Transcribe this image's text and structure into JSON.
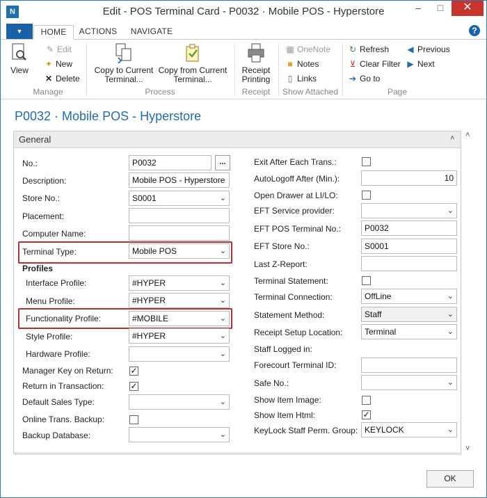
{
  "window": {
    "title": "Edit - POS Terminal Card - P0032 · Mobile POS - Hyperstore",
    "min_glyph": "–",
    "max_glyph": "□",
    "close_glyph": "✕"
  },
  "menubar": {
    "file_glyph": "▼",
    "tabs": [
      "HOME",
      "ACTIONS",
      "NAVIGATE"
    ],
    "help_glyph": "?"
  },
  "ribbon": {
    "manage": {
      "label": "Manage",
      "view": "View",
      "edit": "Edit",
      "new": "New",
      "delete": "Delete"
    },
    "process": {
      "label": "Process",
      "copy_to_line1": "Copy to Current",
      "copy_to_line2": "Terminal...",
      "copy_from_line1": "Copy from Current",
      "copy_from_line2": "Terminal..."
    },
    "receipt": {
      "label": "Receipt",
      "printing_line1": "Receipt",
      "printing_line2": "Printing"
    },
    "show_attached": {
      "label": "Show Attached",
      "onenote": "OneNote",
      "notes": "Notes",
      "links": "Links"
    },
    "page": {
      "label": "Page",
      "refresh": "Refresh",
      "clear_filter": "Clear Filter",
      "go_to": "Go to",
      "previous": "Previous",
      "next": "Next"
    }
  },
  "page_title": "P0032 · Mobile POS - Hyperstore",
  "fasttab": {
    "title": "General",
    "collapse_glyph": "˄"
  },
  "left": {
    "no": {
      "label": "No.:",
      "value": "P0032"
    },
    "description": {
      "label": "Description:",
      "value": "Mobile POS - Hyperstore"
    },
    "store_no": {
      "label": "Store No.:",
      "value": "S0001"
    },
    "placement": {
      "label": "Placement:",
      "value": ""
    },
    "computer_name": {
      "label": "Computer Name:",
      "value": ""
    },
    "terminal_type": {
      "label": "Terminal Type:",
      "value": "Mobile POS"
    },
    "profiles_heading": "Profiles",
    "interface_profile": {
      "label": "Interface Profile:",
      "value": "#HYPER"
    },
    "menu_profile": {
      "label": "Menu Profile:",
      "value": "#HYPER"
    },
    "functionality_profile": {
      "label": "Functionality Profile:",
      "value": "#MOBILE"
    },
    "style_profile": {
      "label": "Style Profile:",
      "value": "#HYPER"
    },
    "hardware_profile": {
      "label": "Hardware Profile:",
      "value": ""
    },
    "manager_key": {
      "label": "Manager Key on Return:",
      "checked": true
    },
    "return_in_transaction": {
      "label": "Return in Transaction:",
      "checked": true
    },
    "default_sales_type": {
      "label": "Default Sales Type:",
      "value": ""
    },
    "online_trans_backup": {
      "label": "Online Trans. Backup:",
      "checked": false
    },
    "backup_database": {
      "label": "Backup Database:",
      "value": ""
    }
  },
  "right": {
    "exit_after_each": {
      "label": "Exit After Each Trans.:",
      "checked": false
    },
    "autologoff": {
      "label": "AutoLogoff After (Min.):",
      "value": "10"
    },
    "open_drawer": {
      "label": "Open Drawer at LI/LO:",
      "checked": false
    },
    "eft_service_provider": {
      "label": "EFT Service provider:",
      "value": ""
    },
    "eft_pos_terminal_no": {
      "label": "EFT POS Terminal No.:",
      "value": "P0032"
    },
    "eft_store_no": {
      "label": "EFT Store No.:",
      "value": "S0001"
    },
    "last_z_report": {
      "label": "Last Z-Report:",
      "value": ""
    },
    "terminal_statement": {
      "label": "Terminal Statement:",
      "checked": false
    },
    "terminal_connection": {
      "label": "Terminal Connection:",
      "value": "OffLine"
    },
    "statement_method": {
      "label": "Statement Method:",
      "value": "Staff"
    },
    "receipt_setup_location": {
      "label": "Receipt Setup Location:",
      "value": "Terminal"
    },
    "staff_logged_in": {
      "label": "Staff Logged in:"
    },
    "forecourt_terminal_id": {
      "label": "Forecourt Terminal ID:",
      "value": ""
    },
    "safe_no": {
      "label": "Safe No.:",
      "value": ""
    },
    "show_item_image": {
      "label": "Show Item Image:",
      "checked": false
    },
    "show_item_html": {
      "label": "Show Item Html:",
      "checked": true
    },
    "keylock_group": {
      "label": "KeyLock Staff Perm. Group:",
      "value": "KEYLOCK"
    }
  },
  "glyphs": {
    "dropdown": "⌄",
    "check": "✓",
    "ellipsis": "...",
    "scroll_up": "˄",
    "scroll_down": "˅"
  },
  "footer": {
    "ok": "OK"
  },
  "colors": {
    "accent": "#1f6db3",
    "close_button": "#c7352c",
    "highlight": "#c12d2d"
  }
}
